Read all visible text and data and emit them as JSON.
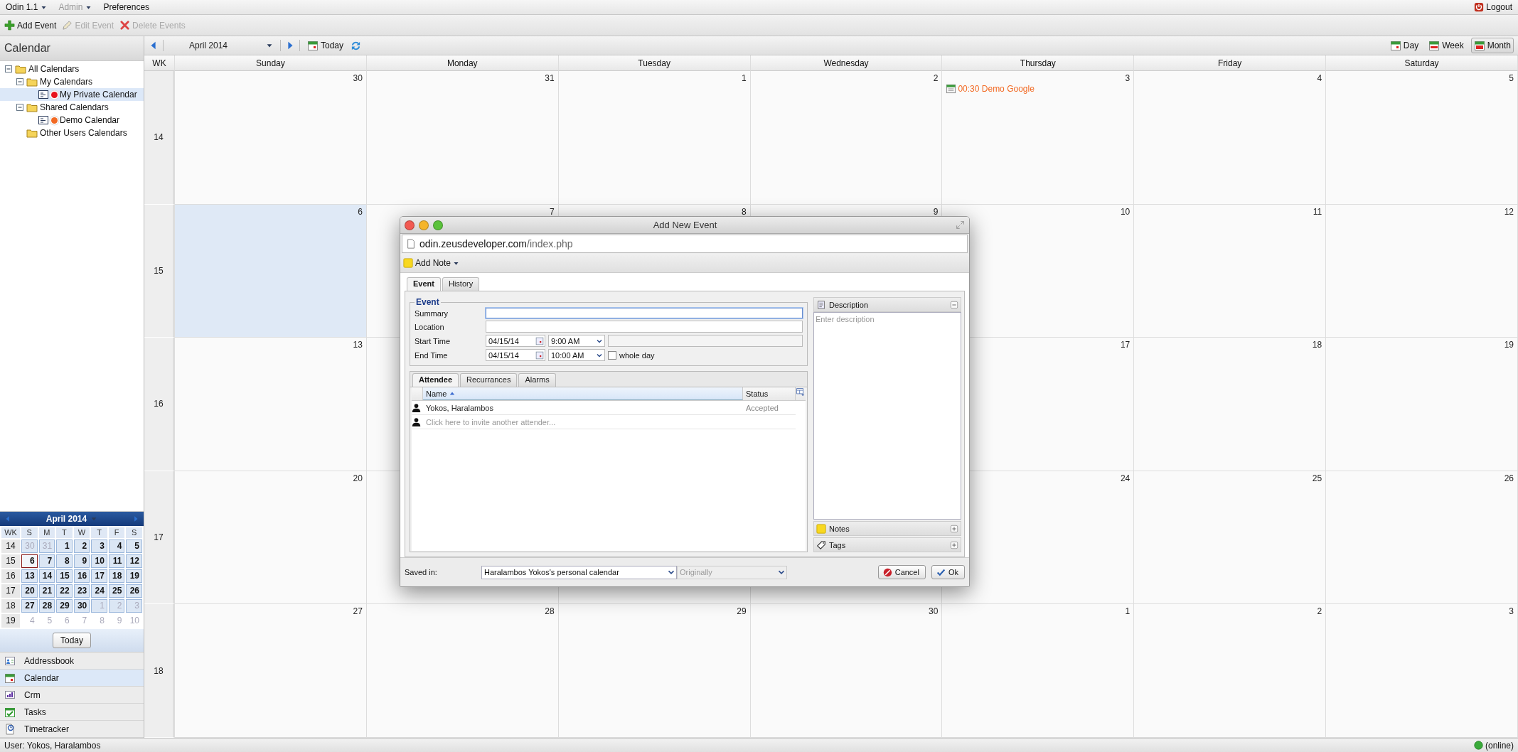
{
  "menu_bar": {
    "items": [
      {
        "label": "Odin 1.1",
        "dropdown": true,
        "disabled": false
      },
      {
        "label": "Admin",
        "dropdown": true,
        "disabled": true
      },
      {
        "label": "Preferences",
        "dropdown": false,
        "disabled": false
      }
    ],
    "logout": "Logout"
  },
  "toolbar": [
    {
      "label": "Add Event",
      "kind": "add",
      "disabled": false
    },
    {
      "label": "Edit Event",
      "kind": "edit",
      "disabled": true
    },
    {
      "label": "Delete Events",
      "kind": "delete",
      "disabled": true
    }
  ],
  "sidebar": {
    "title": "Calendar",
    "tree": [
      {
        "label": "All Calendars",
        "kind": "folder",
        "expanded": true,
        "selected": false,
        "children": [
          {
            "label": "My Calendars",
            "kind": "folder",
            "expanded": true,
            "selected": false,
            "children": [
              {
                "label": "My Private Calendar",
                "kind": "calendar",
                "color": "#e8141b",
                "selected": true
              }
            ]
          },
          {
            "label": "Shared Calendars",
            "kind": "folder",
            "expanded": true,
            "selected": false,
            "children": [
              {
                "label": "Demo Calendar",
                "kind": "calendar",
                "color": "#f26a24",
                "selected": false
              }
            ]
          },
          {
            "label": "Other Users Calendars",
            "kind": "folder",
            "selected": false
          }
        ]
      }
    ],
    "mini_calendar": {
      "title": "April 2014",
      "headers": [
        "WK",
        "S",
        "M",
        "T",
        "W",
        "T",
        "F",
        "S"
      ],
      "weeks": [
        {
          "wk": "14",
          "boxed": true,
          "days": [
            {
              "label": "30",
              "muted": true,
              "today": false
            },
            {
              "label": "31",
              "muted": true,
              "today": false
            },
            {
              "label": "1",
              "muted": false,
              "today": false
            },
            {
              "label": "2",
              "muted": false,
              "today": false
            },
            {
              "label": "3",
              "muted": false,
              "today": false
            },
            {
              "label": "4",
              "muted": false,
              "today": false
            },
            {
              "label": "5",
              "muted": false,
              "today": false
            }
          ]
        },
        {
          "wk": "15",
          "boxed": true,
          "days": [
            {
              "label": "6",
              "muted": false,
              "today": true
            },
            {
              "label": "7",
              "muted": false,
              "today": false
            },
            {
              "label": "8",
              "muted": false,
              "today": false
            },
            {
              "label": "9",
              "muted": false,
              "today": false
            },
            {
              "label": "10",
              "muted": false,
              "today": false
            },
            {
              "label": "11",
              "muted": false,
              "today": false
            },
            {
              "label": "12",
              "muted": false,
              "today": false
            }
          ]
        },
        {
          "wk": "16",
          "boxed": true,
          "days": [
            {
              "label": "13",
              "muted": false,
              "today": false
            },
            {
              "label": "14",
              "muted": false,
              "today": false
            },
            {
              "label": "15",
              "muted": false,
              "today": false
            },
            {
              "label": "16",
              "muted": false,
              "today": false
            },
            {
              "label": "17",
              "muted": false,
              "today": false
            },
            {
              "label": "18",
              "muted": false,
              "today": false
            },
            {
              "label": "19",
              "muted": false,
              "today": false
            }
          ]
        },
        {
          "wk": "17",
          "boxed": true,
          "days": [
            {
              "label": "20",
              "muted": false,
              "today": false
            },
            {
              "label": "21",
              "muted": false,
              "today": false
            },
            {
              "label": "22",
              "muted": false,
              "today": false
            },
            {
              "label": "23",
              "muted": false,
              "today": false
            },
            {
              "label": "24",
              "muted": false,
              "today": false
            },
            {
              "label": "25",
              "muted": false,
              "today": false
            },
            {
              "label": "26",
              "muted": false,
              "today": false
            }
          ]
        },
        {
          "wk": "18",
          "boxed": true,
          "days": [
            {
              "label": "27",
              "muted": false,
              "today": false
            },
            {
              "label": "28",
              "muted": false,
              "today": false
            },
            {
              "label": "29",
              "muted": false,
              "today": false
            },
            {
              "label": "30",
              "muted": false,
              "today": false
            },
            {
              "label": "1",
              "muted": true,
              "today": false
            },
            {
              "label": "2",
              "muted": true,
              "today": false
            },
            {
              "label": "3",
              "muted": true,
              "today": false
            }
          ]
        },
        {
          "wk": "19",
          "boxed": false,
          "days": [
            {
              "label": "4",
              "muted": true,
              "today": false
            },
            {
              "label": "5",
              "muted": true,
              "today": false
            },
            {
              "label": "6",
              "muted": true,
              "today": false
            },
            {
              "label": "7",
              "muted": true,
              "today": false
            },
            {
              "label": "8",
              "muted": true,
              "today": false
            },
            {
              "label": "9",
              "muted": true,
              "today": false
            },
            {
              "label": "10",
              "muted": true,
              "today": false
            }
          ]
        }
      ],
      "today_button": "Today"
    },
    "apps": [
      {
        "label": "Addressbook",
        "selected": false
      },
      {
        "label": "Calendar",
        "selected": true
      },
      {
        "label": "Crm",
        "selected": false
      },
      {
        "label": "Tasks",
        "selected": false
      },
      {
        "label": "Timetracker",
        "selected": false
      }
    ]
  },
  "calendar": {
    "period": "April 2014",
    "today_button": "Today",
    "views": [
      {
        "label": "Day",
        "selected": false
      },
      {
        "label": "Week",
        "selected": false
      },
      {
        "label": "Month",
        "selected": true
      }
    ],
    "week_header": "WK",
    "weekdays": [
      "Sunday",
      "Monday",
      "Tuesday",
      "Wednesday",
      "Thursday",
      "Friday",
      "Saturday"
    ],
    "weeks": [
      {
        "wk": "14",
        "days": [
          {
            "label": "30",
            "today": false
          },
          {
            "label": "31",
            "today": false
          },
          {
            "label": "1",
            "today": false
          },
          {
            "label": "2",
            "today": false
          },
          {
            "label": "3",
            "today": false,
            "events": [
              {
                "text": "00:30 Demo Google",
                "color": "#f26a24"
              }
            ]
          },
          {
            "label": "4",
            "today": false
          },
          {
            "label": "5",
            "today": false
          }
        ]
      },
      {
        "wk": "15",
        "days": [
          {
            "label": "6",
            "today": true
          },
          {
            "label": "7",
            "today": false
          },
          {
            "label": "8",
            "today": false
          },
          {
            "label": "9",
            "today": false
          },
          {
            "label": "10",
            "today": false
          },
          {
            "label": "11",
            "today": false
          },
          {
            "label": "12",
            "today": false
          }
        ]
      },
      {
        "wk": "16",
        "days": [
          {
            "label": "13",
            "today": false
          }
        ],
        "days_after_dialog": [
          {
            "label": "17",
            "today": false
          },
          {
            "label": "18",
            "today": false
          },
          {
            "label": "19",
            "today": false
          }
        ]
      },
      {
        "wk": "17",
        "days": [
          {
            "label": "20",
            "today": false
          }
        ],
        "days_after_dialog": [
          {
            "label": "24",
            "today": false
          },
          {
            "label": "25",
            "today": false
          },
          {
            "label": "26",
            "today": false
          }
        ]
      },
      {
        "wk": "18",
        "days": [
          {
            "label": "27",
            "today": false
          },
          {
            "label": "28",
            "today": false
          },
          {
            "label": "29",
            "today": false
          },
          {
            "label": "30",
            "today": false
          },
          {
            "label": "1",
            "today": false
          },
          {
            "label": "2",
            "today": false
          },
          {
            "label": "3",
            "today": false
          }
        ]
      }
    ]
  },
  "dialog": {
    "title": "Add New Event",
    "url_host": "odin.zeusdeveloper.com",
    "url_path": "/index.php",
    "add_note": "Add Note",
    "tabs": [
      {
        "label": "Event",
        "selected": true
      },
      {
        "label": "History",
        "selected": false
      }
    ],
    "legend": "Event",
    "summary": {
      "label": "Summary",
      "focused": true
    },
    "location": {
      "label": "Location",
      "focused": false
    },
    "start": {
      "label": "Start Time",
      "date": "04/15/14",
      "time": "9:00 AM"
    },
    "end": {
      "label": "End Time",
      "date": "04/15/14",
      "time": "10:00 AM"
    },
    "whole_day": {
      "label": "whole day",
      "checked": false
    },
    "sub_tabs": [
      {
        "label": "Attendee",
        "selected": true
      },
      {
        "label": "Recurrances",
        "selected": false
      },
      {
        "label": "Alarms",
        "selected": false
      }
    ],
    "columns": [
      {
        "label": "Name",
        "sorted": true
      },
      {
        "label": "Status",
        "sorted": false
      }
    ],
    "attendees": [
      {
        "name": "Yokos, Haralambos",
        "status": "Accepted"
      }
    ],
    "invite_placeholder": "Click here to invite another attender...",
    "description": {
      "title": "Description",
      "placeholder": "Enter description"
    },
    "sections": [
      {
        "label": "Notes",
        "kind": "notes"
      },
      {
        "label": "Tags",
        "kind": "tags"
      }
    ],
    "saved_in": {
      "label": "Saved in:",
      "value": "Haralambos Yokos's personal calendar",
      "original": "Originally"
    },
    "buttons": [
      {
        "label": "Cancel",
        "kind": "cancel"
      },
      {
        "label": "Ok",
        "kind": "ok"
      }
    ]
  },
  "status_bar": {
    "user": "User: Yokos, Haralambos",
    "connection": "(online)"
  }
}
